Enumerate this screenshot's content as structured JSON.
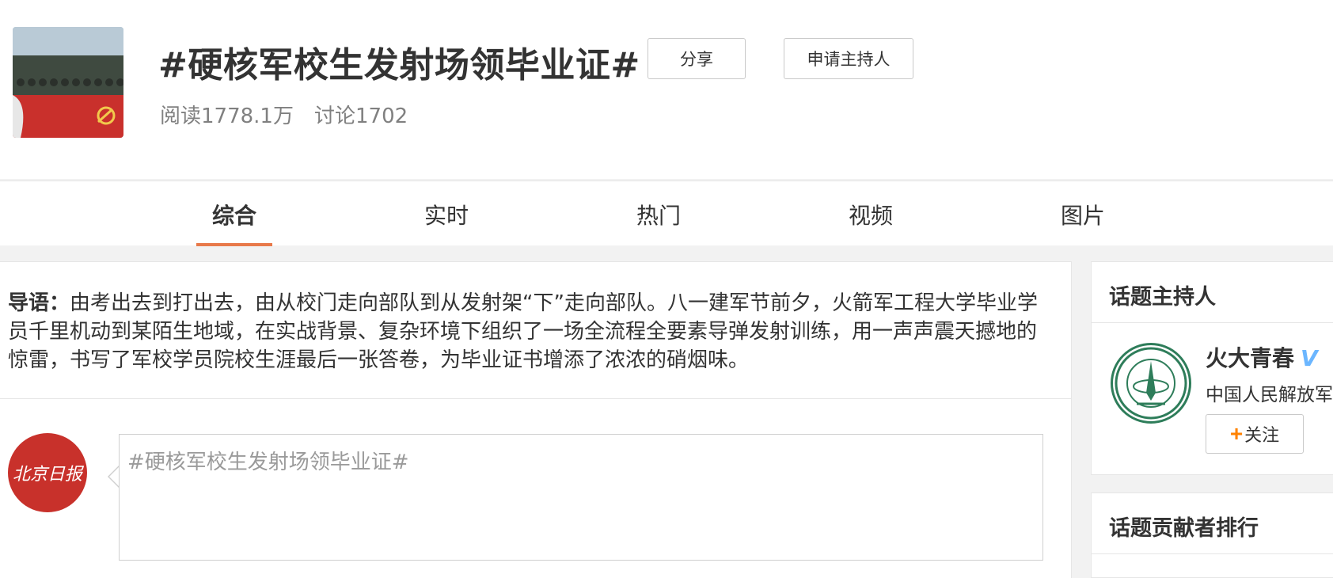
{
  "header": {
    "title": "#硬核军校生发射场领毕业证#",
    "share_label": "分享",
    "host_apply_label": "申请主持人",
    "reads": "阅读1778.1万",
    "discussions": "讨论1702"
  },
  "tabs": [
    {
      "label": "综合",
      "active": true
    },
    {
      "label": "实时",
      "active": false
    },
    {
      "label": "热门",
      "active": false
    },
    {
      "label": "视频",
      "active": false
    },
    {
      "label": "图片",
      "active": false
    }
  ],
  "intro": {
    "label": "导语：",
    "text": "由考出去到打出去，由从校门走向部队到从发射架“下”走向部队。八一建军节前夕，火箭军工程大学毕业学员千里机动到某陌生地域，在实战背景、复杂环境下组织了一场全流程全要素导弹发射训练，用一声声震天撼地的惊雷，书写了军校学员院校生涯最后一张答卷，为毕业证书增添了浓浓的硝烟味。"
  },
  "composer": {
    "avatar_text": "北京日报",
    "placeholder": "#硬核军校生发射场领毕业证#"
  },
  "side": {
    "host_title": "话题主持人",
    "host_name": "火大青春",
    "host_desc": "中国人民解放军",
    "follow_label": "关注",
    "rank_title": "话题贡献者排行"
  },
  "colors": {
    "accent": "#e8794a",
    "follow_plus": "#ff8200",
    "verify": "#6bb6ff",
    "beijing_daily_red": "#c8312b"
  }
}
